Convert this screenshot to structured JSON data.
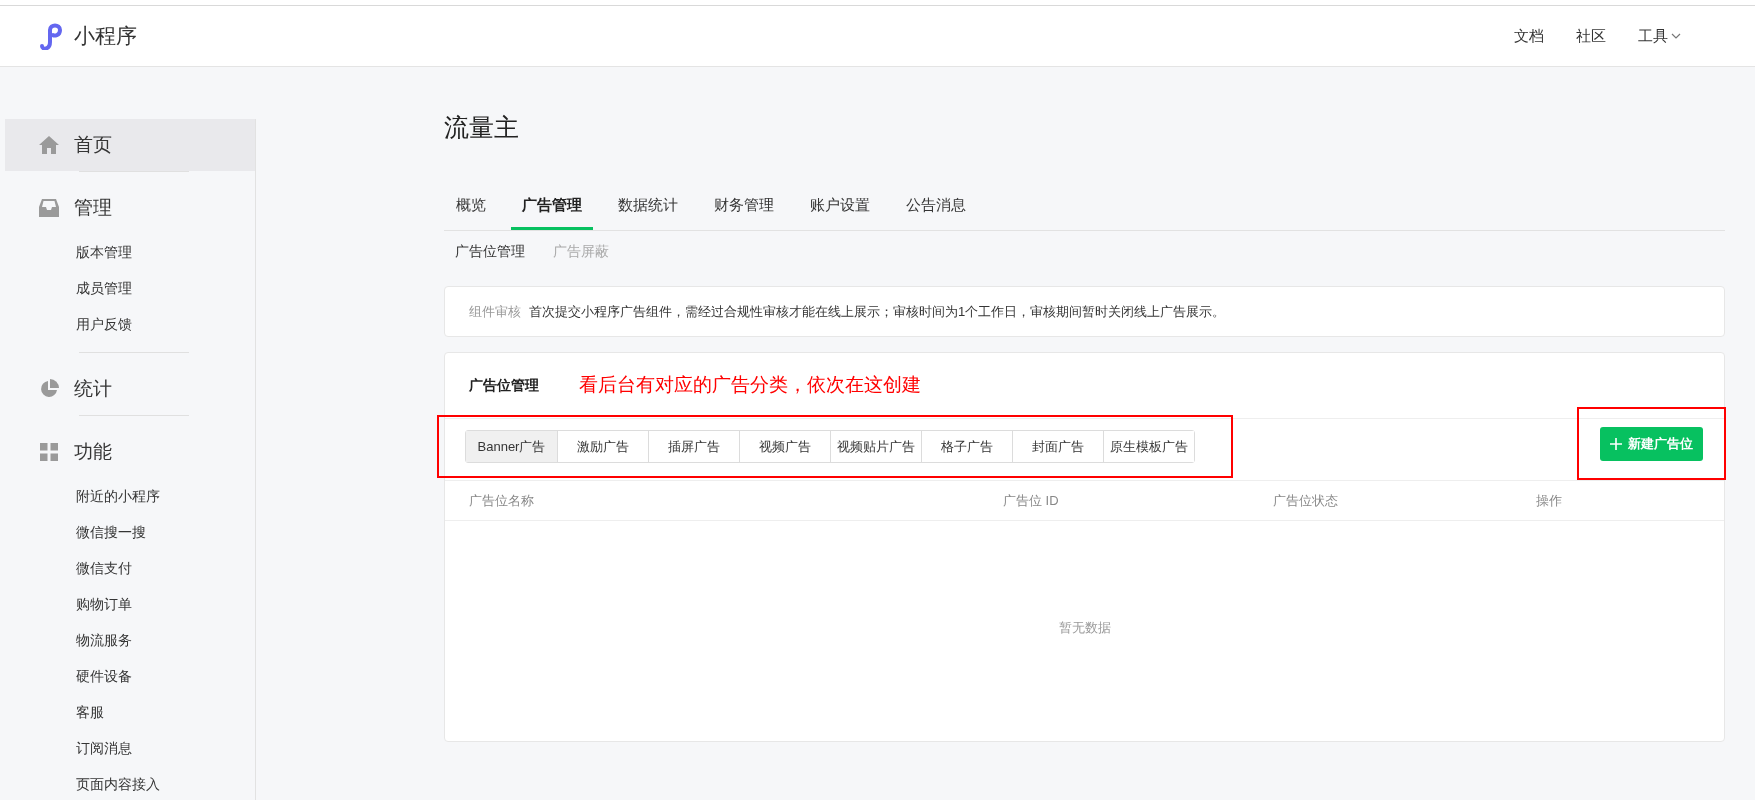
{
  "header": {
    "logo_text": "小程序",
    "nav": [
      {
        "label": "文档",
        "dropdown": false
      },
      {
        "label": "社区",
        "dropdown": false
      },
      {
        "label": "工具",
        "dropdown": true
      }
    ]
  },
  "sidebar": {
    "sections": [
      {
        "label": "首页",
        "selected": true
      },
      {
        "label": "管理",
        "selected": false,
        "children": [
          {
            "label": "版本管理"
          },
          {
            "label": "成员管理"
          },
          {
            "label": "用户反馈"
          }
        ]
      },
      {
        "label": "统计",
        "selected": false
      },
      {
        "label": "功能",
        "selected": false,
        "children": [
          {
            "label": "附近的小程序"
          },
          {
            "label": "微信搜一搜"
          },
          {
            "label": "微信支付"
          },
          {
            "label": "购物订单"
          },
          {
            "label": "物流服务"
          },
          {
            "label": "硬件设备"
          },
          {
            "label": "客服"
          },
          {
            "label": "订阅消息"
          },
          {
            "label": "页面内容接入"
          }
        ]
      }
    ]
  },
  "page_title": "流量主",
  "tabs": [
    {
      "label": "概览",
      "selected": false
    },
    {
      "label": "广告管理",
      "selected": true
    },
    {
      "label": "数据统计",
      "selected": false
    },
    {
      "label": "财务管理",
      "selected": false
    },
    {
      "label": "账户设置",
      "selected": false
    },
    {
      "label": "公告消息",
      "selected": false
    }
  ],
  "subtabs": [
    {
      "label": "广告位管理",
      "selected": true
    },
    {
      "label": "广告屏蔽",
      "selected": false
    }
  ],
  "notice": {
    "label": "组件审核",
    "text": "首次提交小程序广告组件，需经过合规性审核才能在线上展示；审核时间为1个工作日，审核期间暂时关闭线上广告展示。"
  },
  "panel": {
    "title": "广告位管理",
    "annotation": "看后台有对应的广告分类，依次在这创建",
    "ad_types": [
      {
        "label": "Banner广告",
        "selected": true
      },
      {
        "label": "激励广告",
        "selected": false
      },
      {
        "label": "插屏广告",
        "selected": false
      },
      {
        "label": "视频广告",
        "selected": false
      },
      {
        "label": "视频贴片广告",
        "selected": false
      },
      {
        "label": "格子广告",
        "selected": false
      },
      {
        "label": "封面广告",
        "selected": false
      },
      {
        "label": "原生模板广告",
        "selected": false
      }
    ],
    "new_button": "新建广告位",
    "table": {
      "columns": [
        "广告位名称",
        "广告位 ID",
        "广告位状态",
        "操作"
      ],
      "empty_text": "暂无数据"
    }
  }
}
